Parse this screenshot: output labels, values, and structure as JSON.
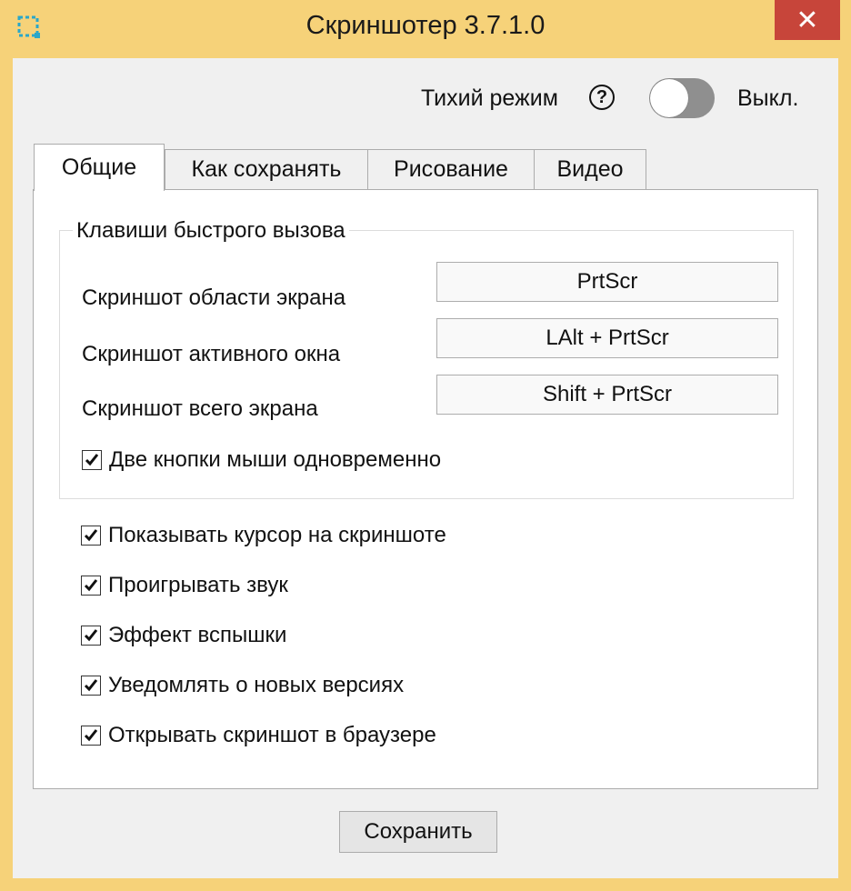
{
  "window": {
    "title": "Скриншотер 3.7.1.0",
    "close_glyph": "✕",
    "accent_color": "#f6d279",
    "close_color": "#c7453a",
    "icon": "screenshot-area-icon"
  },
  "quiet_mode": {
    "label": "Тихий режим",
    "help_glyph": "?",
    "state_text": "Выкл.",
    "enabled": false
  },
  "tabs": [
    {
      "label": "Общие",
      "active": true
    },
    {
      "label": "Как сохранять",
      "active": false
    },
    {
      "label": "Рисование",
      "active": false
    },
    {
      "label": "Видео",
      "active": false
    }
  ],
  "hotkeys": {
    "group_title": "Клавиши быстрого вызова",
    "items": [
      {
        "label": "Скриншот области экрана",
        "value": "PrtScr"
      },
      {
        "label": "Скриншот активного окна",
        "value": "LAlt + PrtScr"
      },
      {
        "label": "Скриншот всего экрана",
        "value": "Shift + PrtScr"
      }
    ],
    "mouse_option": {
      "label": "Две кнопки мыши одновременно",
      "checked": true
    }
  },
  "options": [
    {
      "label": "Показывать курсор на скриншоте",
      "checked": true
    },
    {
      "label": "Проигрывать звук",
      "checked": true
    },
    {
      "label": "Эффект вспышки",
      "checked": true
    },
    {
      "label": "Уведомлять о новых версиях",
      "checked": true
    },
    {
      "label": "Открывать скриншот в браузере",
      "checked": true
    }
  ],
  "save_button": "Сохранить"
}
